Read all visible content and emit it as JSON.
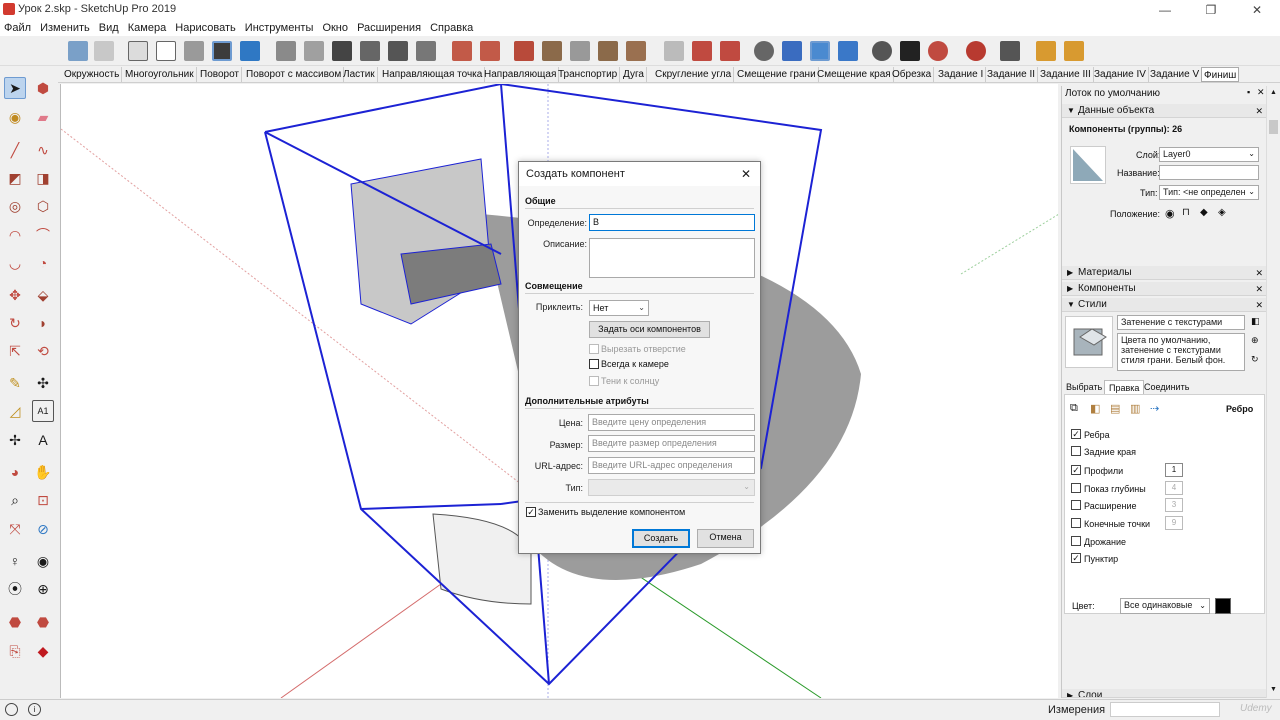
{
  "window": {
    "title": "Урок 2.skp - SketchUp Pro 2019",
    "minimize": "—",
    "maximize": "❐",
    "close": "✕"
  },
  "menu": [
    "Файл",
    "Изменить",
    "Вид",
    "Камера",
    "Нарисовать",
    "Инструменты",
    "Окно",
    "Расширения",
    "Справка"
  ],
  "scene_tabs": [
    "Окружность",
    "Многоугольник",
    "Поворот",
    "Поворот с массивом",
    "Ластик",
    "Направляющая точка",
    "Направляющая",
    "Транспортир",
    "Дуга",
    "Скругление угла",
    "Смещение грани",
    "Смещение края",
    "Обрезка",
    "Задание I",
    "Задание II",
    "Задание III",
    "Задание IV",
    "Задание V",
    "Финиш"
  ],
  "active_tab": "Финиш",
  "dialog": {
    "title": "Создать компонент",
    "close": "✕",
    "general_header": "Общие",
    "definition_label": "Определение:",
    "definition_value": "В",
    "description_label": "Описание:",
    "description_value": "",
    "alignment_header": "Совмещение",
    "glue_label": "Приклеить:",
    "glue_value": "Нет",
    "set_axes_button": "Задать оси компонентов",
    "cut_opening": "Вырезать отверстие",
    "always_face_camera": "Всегда к камере",
    "shadows_face_sun": "Тени к солнцу",
    "advanced_header": "Дополнительные атрибуты",
    "price_label": "Цена:",
    "price_placeholder": "Введите цену определения",
    "size_label": "Размер:",
    "size_placeholder": "Введите размер определения",
    "url_label": "URL-адрес:",
    "url_placeholder": "Введите URL-адрес определения",
    "type_label": "Тип:",
    "type_value": "",
    "replace_selection": "Заменить выделение компонентом",
    "replace_selection_checked": true,
    "create_button": "Создать",
    "cancel_button": "Отмена"
  },
  "tray": {
    "title": "Лоток по умолчанию",
    "pin": "▪",
    "close": "✕",
    "entity_info": {
      "header": "Данные объекта",
      "count": "Компоненты (группы): 26",
      "layer_label": "Слой:",
      "layer_value": "Layer0",
      "name_label": "Название:",
      "name_value": "",
      "type_label": "Тип:",
      "type_value": "Тип: <не определен",
      "position_label": "Положение:"
    },
    "materials_header": "Материалы",
    "components_header": "Компоненты",
    "styles": {
      "header": "Стили",
      "style_name": "Затенение с текстурами",
      "style_desc": "Цвета по умолчанию, затенение с текстурами стиля грани. Белый фон.",
      "tabs": [
        "Выбрать",
        "Правка",
        "Соединить"
      ],
      "active_tab": "Правка",
      "section_label": "Ребро",
      "options": [
        {
          "label": "Ребра",
          "checked": true,
          "value": ""
        },
        {
          "label": "Задние края",
          "checked": false,
          "value": ""
        },
        {
          "label": "Профили",
          "checked": true,
          "value": "1"
        },
        {
          "label": "Показ глубины",
          "checked": false,
          "value": "4"
        },
        {
          "label": "Расширение",
          "checked": false,
          "value": "3"
        },
        {
          "label": "Конечные точки",
          "checked": false,
          "value": "9"
        },
        {
          "label": "Дрожание",
          "checked": false,
          "value": ""
        },
        {
          "label": "Пунктир",
          "checked": true,
          "value": ""
        }
      ],
      "color_label": "Цвет:",
      "color_value": "Все одинаковые",
      "color_swatch": "#000000"
    },
    "layers_header": "Слои"
  },
  "status": {
    "measurements_label": "Измерения",
    "measurements_value": "",
    "watermark": "Udemy"
  },
  "colors": {
    "selection_blue": "#1c22d4",
    "axis_red": "#d46b6b",
    "axis_green": "#2a9a2a",
    "shadow_gray": "#9c9c9c",
    "button_focus": "#0078d7"
  }
}
